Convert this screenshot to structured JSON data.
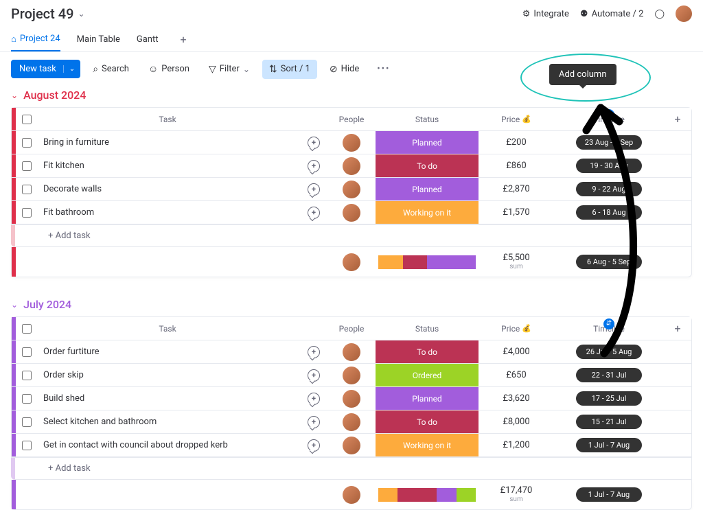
{
  "header": {
    "title": "Project 49",
    "integrate": "Integrate",
    "automate": "Automate / 2"
  },
  "tabs": {
    "project": "Project 24",
    "main": "Main Table",
    "gantt": "Gantt"
  },
  "toolbar": {
    "new_task": "New task",
    "search": "Search",
    "person": "Person",
    "filter": "Filter",
    "sort": "Sort / 1",
    "hide": "Hide"
  },
  "columns": {
    "task": "Task",
    "people": "People",
    "status": "Status",
    "price": "Price",
    "timeline": "Timeline"
  },
  "tooltip": "Add column",
  "groups": [
    {
      "id": "aug",
      "title": "August 2024",
      "rows": [
        {
          "task": "Bring in furniture",
          "status": "Planned",
          "status_cls": "st-planned",
          "price": "£200",
          "timeline": "23 Aug - 5 Sep"
        },
        {
          "task": "Fit kitchen",
          "status": "To do",
          "status_cls": "st-todo",
          "price": "£860",
          "timeline": "19 - 30 Aug"
        },
        {
          "task": "Decorate walls",
          "status": "Planned",
          "status_cls": "st-planned",
          "price": "£2,870",
          "timeline": "9 - 22 Aug"
        },
        {
          "task": "Fit bathroom",
          "status": "Working on it",
          "status_cls": "st-working",
          "price": "£1,570",
          "timeline": "6 - 18 Aug"
        }
      ],
      "add_task": "+ Add task",
      "summary": {
        "price": "£5,500",
        "label": "sum",
        "timeline": "6 Aug - 5 Sep",
        "segs": [
          [
            "#fdab3d",
            25
          ],
          [
            "#bb3354",
            25
          ],
          [
            "#a25ddc",
            50
          ]
        ]
      }
    },
    {
      "id": "jul",
      "title": "July 2024",
      "rows": [
        {
          "task": "Order furtiture",
          "status": "To do",
          "status_cls": "st-todo",
          "price": "£4,000",
          "timeline": "26 Jul - 5 Aug"
        },
        {
          "task": "Order skip",
          "status": "Ordered",
          "status_cls": "st-ordered",
          "price": "£650",
          "timeline": "22 - 31 Jul"
        },
        {
          "task": "Build shed",
          "status": "Planned",
          "status_cls": "st-planned",
          "price": "£3,620",
          "timeline": "17 - 25 Jul"
        },
        {
          "task": "Select kitchen and bathroom",
          "status": "To do",
          "status_cls": "st-todo",
          "price": "£8,000",
          "timeline": "15 - 21 Jul"
        },
        {
          "task": "Get in contact with council about dropped kerb",
          "status": "Working on it",
          "status_cls": "st-working",
          "price": "£1,200",
          "timeline": "1 Jul - 7 Aug"
        }
      ],
      "add_task": "+ Add task",
      "summary": {
        "price": "£17,470",
        "label": "sum",
        "timeline": "1 Jul - 7 Aug",
        "segs": [
          [
            "#fdab3d",
            20
          ],
          [
            "#bb3354",
            40
          ],
          [
            "#a25ddc",
            20
          ],
          [
            "#9cd326",
            20
          ]
        ]
      }
    }
  ]
}
